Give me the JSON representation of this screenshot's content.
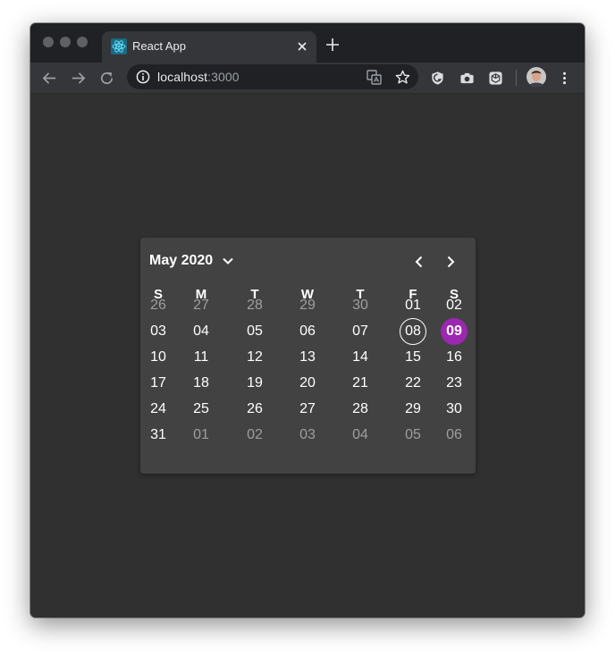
{
  "browser": {
    "tab_title": "React App",
    "url_host": "localhost",
    "url_port": ":3000",
    "icons": {
      "back": "arrow-left-icon",
      "forward": "arrow-right-icon",
      "reload": "reload-icon",
      "site_info": "info-icon",
      "translate": "translate-icon",
      "bookmark": "star-icon",
      "extensions": [
        "shield-extension-icon",
        "camera-extension-icon",
        "cube-extension-icon"
      ],
      "menu": "more-vertical-icon"
    }
  },
  "calendar": {
    "month_label": "May 2020",
    "accent_color": "#9c27b0",
    "weekdays": [
      "S",
      "M",
      "T",
      "W",
      "T",
      "F",
      "S"
    ],
    "weeks": [
      [
        "26",
        "27",
        "28",
        "29",
        "30",
        "01",
        "02"
      ],
      [
        "03",
        "04",
        "05",
        "06",
        "07",
        "08",
        "09"
      ],
      [
        "10",
        "11",
        "12",
        "13",
        "14",
        "15",
        "16"
      ],
      [
        "17",
        "18",
        "19",
        "20",
        "21",
        "22",
        "23"
      ],
      [
        "24",
        "25",
        "26",
        "27",
        "28",
        "29",
        "30"
      ],
      [
        "31",
        "01",
        "02",
        "03",
        "04",
        "05",
        "06"
      ]
    ],
    "today": "08",
    "selected": "09"
  }
}
